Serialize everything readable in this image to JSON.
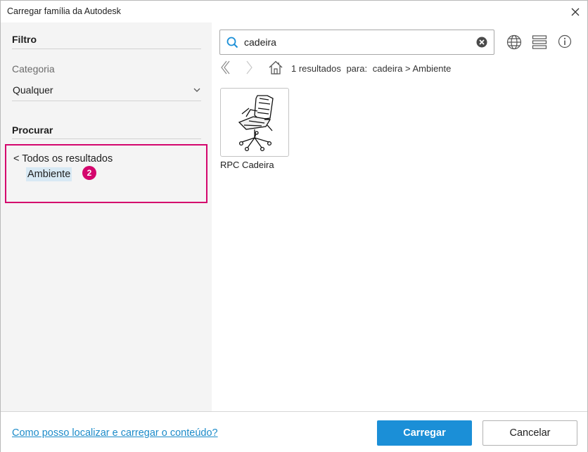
{
  "window": {
    "title": "Carregar família da Autodesk"
  },
  "filter": {
    "heading": "Filtro",
    "category_label": "Categoria",
    "category_value": "Qualquer"
  },
  "browse": {
    "heading": "Procurar",
    "back_link": "< Todos os resultados",
    "current_node": "Ambiente",
    "badge": "2",
    "highlight_color": "#d4066d"
  },
  "search": {
    "query": "cadeira",
    "placeholder": ""
  },
  "toolbar": {
    "icons": [
      "globe-icon",
      "list-view-icon",
      "info-icon"
    ]
  },
  "navigation": {
    "results_count": "1 resultados",
    "results_for": "para:",
    "breadcrumb": "cadeira > Ambiente"
  },
  "results": [
    {
      "label": "RPC Cadeira",
      "icon": "office-chair-thumbnail"
    }
  ],
  "footer": {
    "help_link": "Como posso localizar e carregar o conteúdo?",
    "load_button": "Carregar",
    "cancel_button": "Cancelar",
    "accent_color": "#1b8fd7"
  }
}
